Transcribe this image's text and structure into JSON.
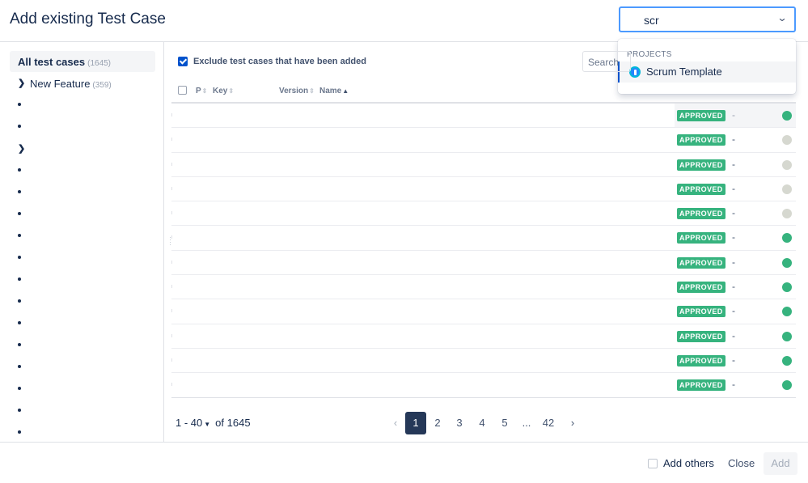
{
  "dialog": {
    "title": "Add existing Test Case"
  },
  "project_select": {
    "value": "scr",
    "group_label": "PROJECTS",
    "options": [
      {
        "label": "Scrum Template",
        "icon": "project-icon"
      }
    ]
  },
  "tree": {
    "all_label": "All test cases",
    "all_count": "(1645)",
    "feature_label": "New Feature",
    "feature_count": "(359)"
  },
  "filter": {
    "exclude_label": "Exclude test cases that have been added",
    "exclude_checked": true,
    "search_placeholder": "Search"
  },
  "table": {
    "headers": {
      "priority": "P",
      "key": "Key",
      "version": "Version",
      "name": "Name"
    },
    "sort_icon": "⇕",
    "sort_asc_icon": "▲",
    "rows": [
      {
        "status": "APPROVED",
        "dash": "-",
        "dot": "green"
      },
      {
        "status": "APPROVED",
        "dash": "-",
        "dot": "grey"
      },
      {
        "status": "APPROVED",
        "dash": "-",
        "dot": "grey"
      },
      {
        "status": "APPROVED",
        "dash": "-",
        "dot": "grey"
      },
      {
        "status": "APPROVED",
        "dash": "-",
        "dot": "grey"
      },
      {
        "status": "APPROVED",
        "dash": "-",
        "dot": "green"
      },
      {
        "status": "APPROVED",
        "dash": "-",
        "dot": "green"
      },
      {
        "status": "APPROVED",
        "dash": "-",
        "dot": "green"
      },
      {
        "status": "APPROVED",
        "dash": "-",
        "dot": "green"
      },
      {
        "status": "APPROVED",
        "dash": "-",
        "dot": "green"
      },
      {
        "status": "APPROVED",
        "dash": "-",
        "dot": "green"
      },
      {
        "status": "APPROVED",
        "dash": "-",
        "dot": "green"
      }
    ]
  },
  "pagination": {
    "range": "1 - 40",
    "of_total": "of 1645",
    "prev_icon": "‹",
    "next_icon": "›",
    "pages": [
      "1",
      "2",
      "3",
      "4",
      "5",
      "...",
      "42"
    ],
    "active_page": "1"
  },
  "footer": {
    "add_others_label": "Add others",
    "close_label": "Close",
    "add_label": "Add"
  },
  "colors": {
    "approved": "#36b37e",
    "dot_green": "#36b37e",
    "dot_grey": "#d6d8d0",
    "primary": "#0052cc",
    "active_page": "#253858"
  }
}
